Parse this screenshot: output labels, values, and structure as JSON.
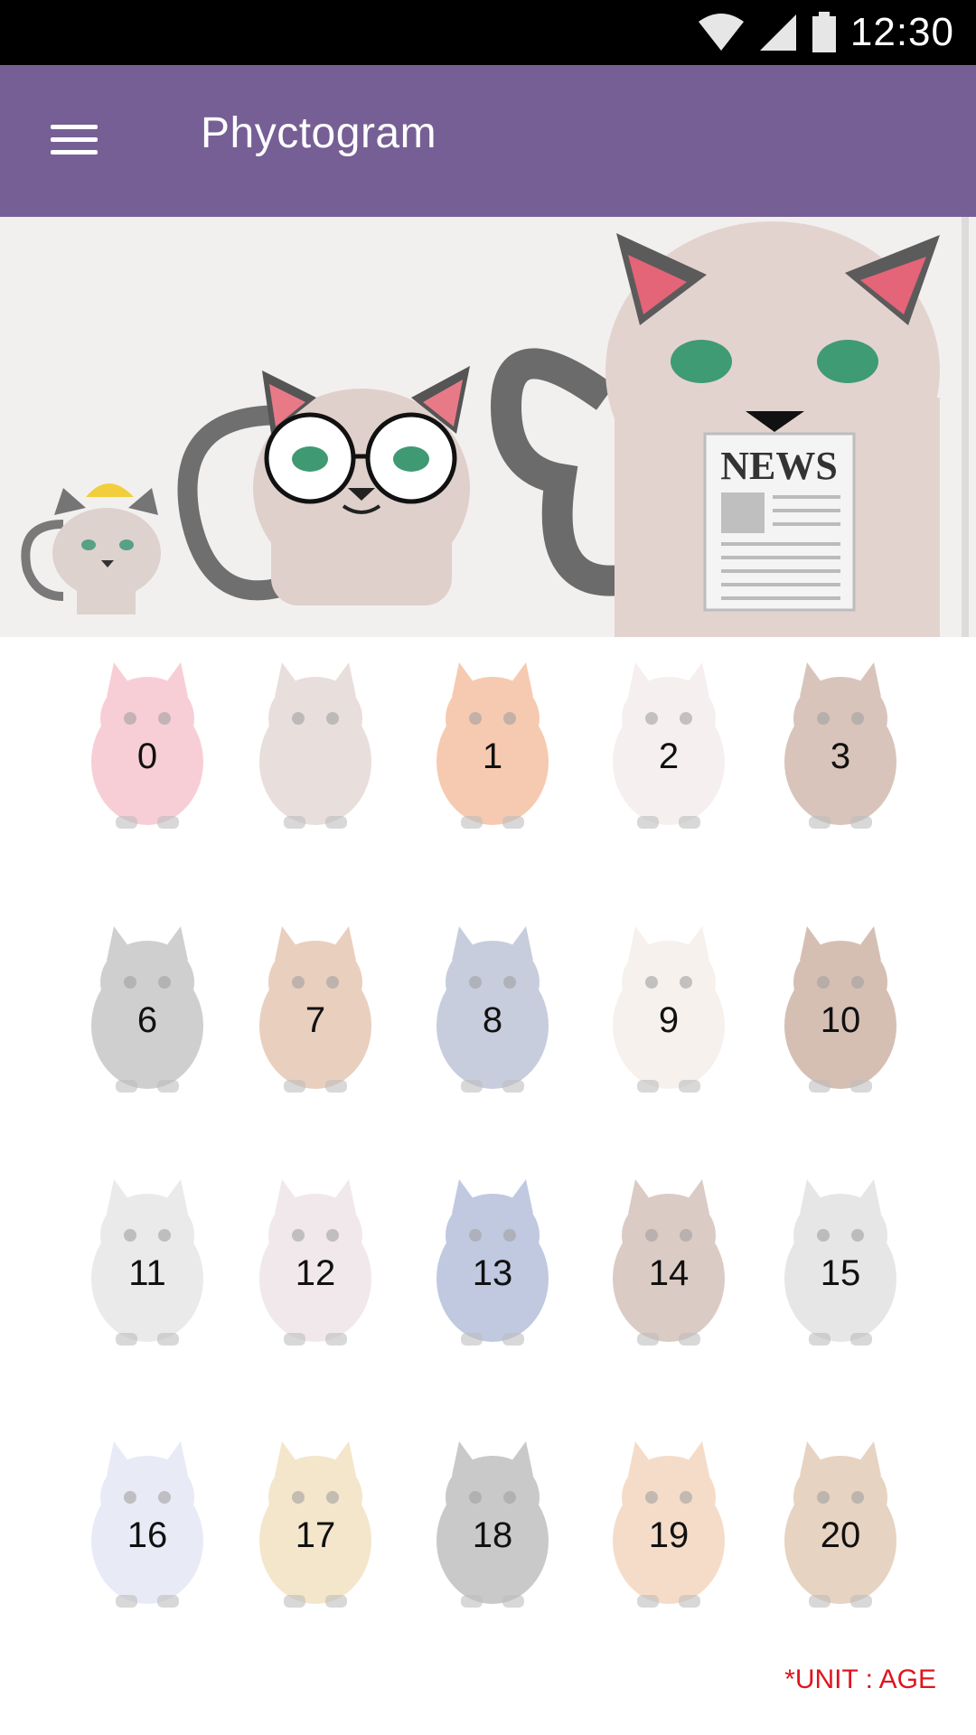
{
  "status_bar": {
    "time": "12:30",
    "icons": [
      "wifi-icon",
      "signal-icon",
      "battery-icon"
    ]
  },
  "app_bar": {
    "title": "Phyctogram",
    "menu_icon": "hamburger-menu-icon"
  },
  "banner": {
    "newspaper_text": "NEWS"
  },
  "age_grid": [
    {
      "animal": "pig",
      "label": "0",
      "color": "#f3a7b6"
    },
    {
      "animal": "cat",
      "label": "",
      "color": "#d6c4c0"
    },
    {
      "animal": "fox",
      "label": "1",
      "color": "#f0a070"
    },
    {
      "animal": "rabbit",
      "label": "2",
      "color": "#efe3e3"
    },
    {
      "animal": "dog",
      "label": "3",
      "color": "#b99483"
    },
    {
      "animal": "owl",
      "label": "6",
      "color": "#a9a9a9"
    },
    {
      "animal": "chicken",
      "label": "7",
      "color": "#d8a88a"
    },
    {
      "animal": "penguin",
      "label": "8",
      "color": "#9aa6c0"
    },
    {
      "animal": "sheep",
      "label": "9",
      "color": "#efe6df"
    },
    {
      "animal": "monkey",
      "label": "10",
      "color": "#b48b76"
    },
    {
      "animal": "zebra",
      "label": "11",
      "color": "#d9d9d9"
    },
    {
      "animal": "cow",
      "label": "12",
      "color": "#e6d7dc"
    },
    {
      "animal": "donkey",
      "label": "13",
      "color": "#8e9ec8"
    },
    {
      "animal": "deer",
      "label": "14",
      "color": "#bfa197"
    },
    {
      "animal": "panda",
      "label": "15",
      "color": "#d3d3d3"
    },
    {
      "animal": "elephant",
      "label": "16",
      "color": "#d7daf0"
    },
    {
      "animal": "leopard",
      "label": "17",
      "color": "#ead2a1"
    },
    {
      "animal": "panther",
      "label": "18",
      "color": "#9e9e9e"
    },
    {
      "animal": "tiger",
      "label": "19",
      "color": "#edc19c"
    },
    {
      "animal": "lion",
      "label": "20",
      "color": "#d3b08f"
    }
  ],
  "footer": {
    "unit_note": "*UNIT : AGE"
  }
}
